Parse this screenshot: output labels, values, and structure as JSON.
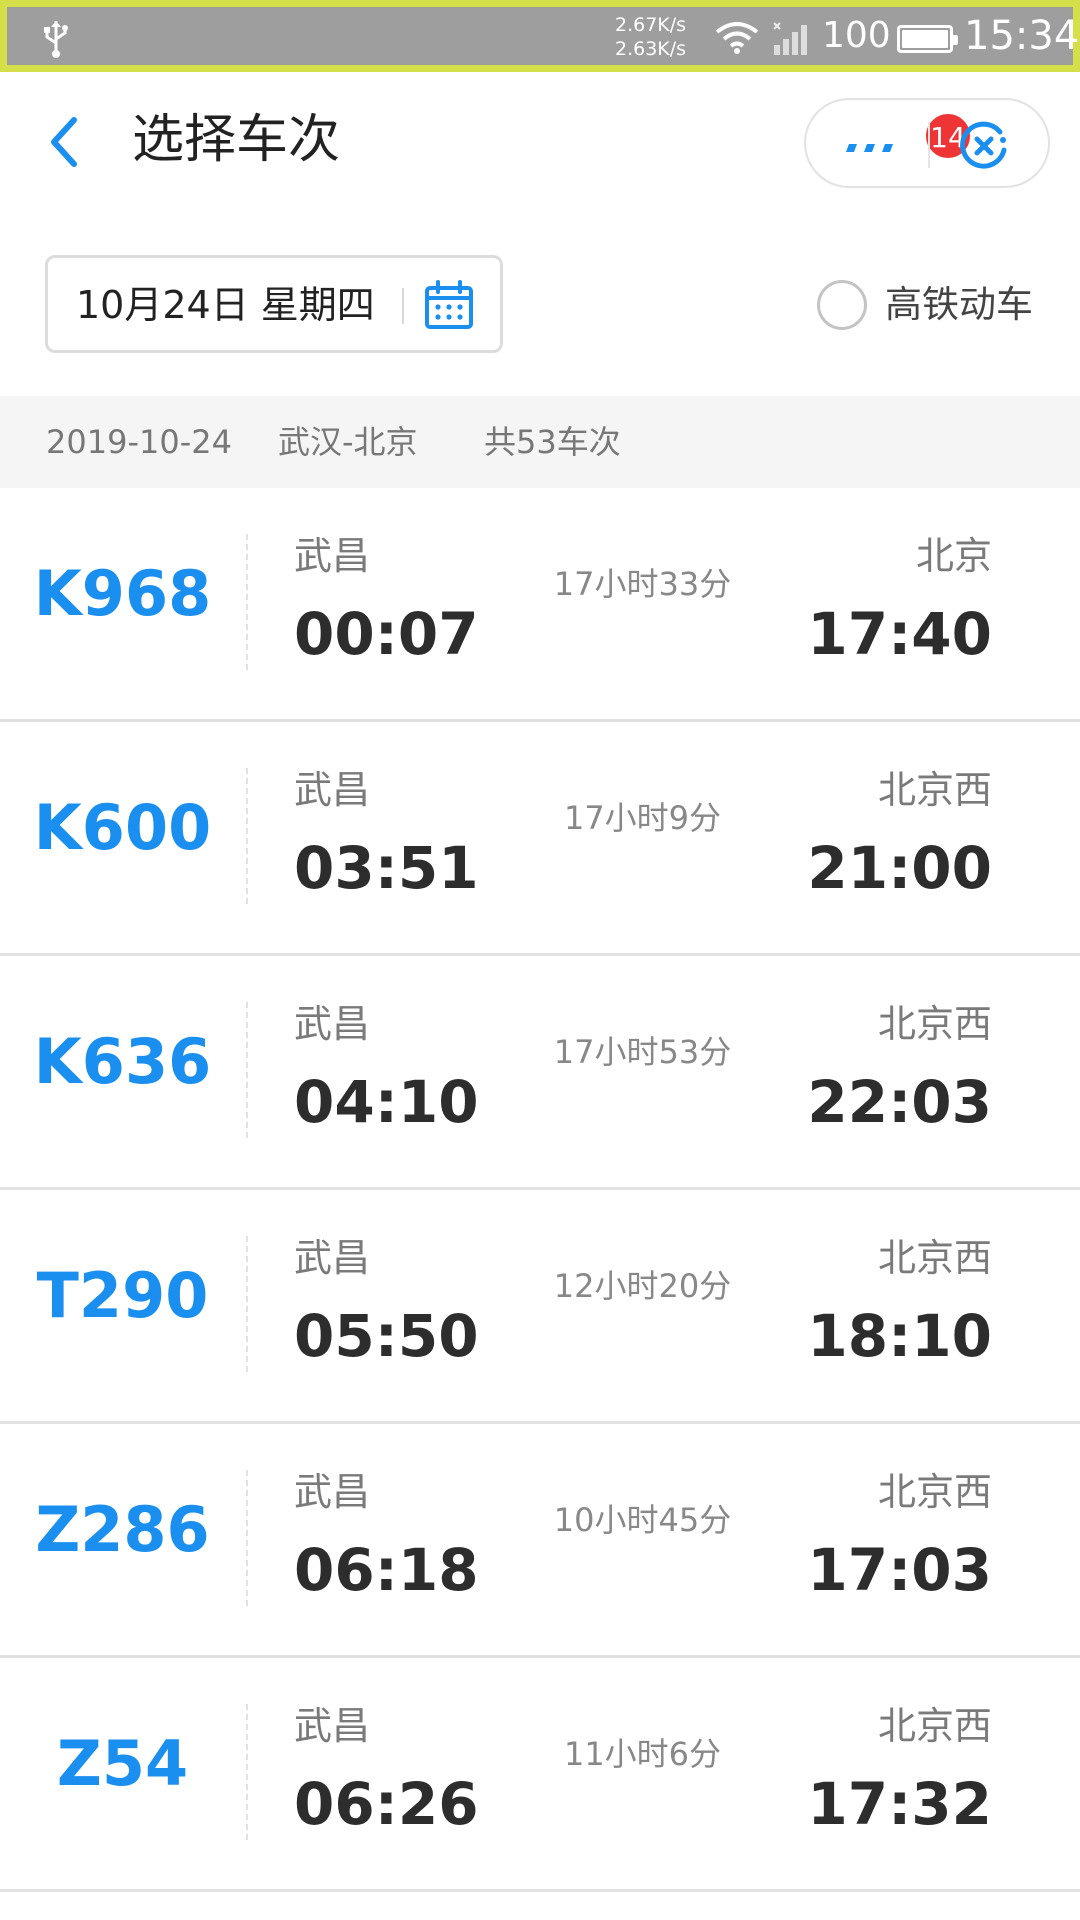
{
  "status_bar": {
    "speed_up": "2.67K/s",
    "speed_down": "2.63K/s",
    "battery": "100",
    "time": "15:34"
  },
  "header": {
    "title": "选择车次",
    "badge_count": "14",
    "accent": "#1b8ff0"
  },
  "date_selector": {
    "date_label": "10月24日 星期四"
  },
  "filter": {
    "label": "高铁动车",
    "checked": false
  },
  "info": {
    "date": "2019-10-24",
    "route": "武汉-北京",
    "count": "共53车次"
  },
  "trains": [
    {
      "no": "K968",
      "from": "武昌",
      "dep": "00:07",
      "duration": "17小时33分",
      "to": "北京",
      "arr": "17:40"
    },
    {
      "no": "K600",
      "from": "武昌",
      "dep": "03:51",
      "duration": "17小时9分",
      "to": "北京西",
      "arr": "21:00"
    },
    {
      "no": "K636",
      "from": "武昌",
      "dep": "04:10",
      "duration": "17小时53分",
      "to": "北京西",
      "arr": "22:03"
    },
    {
      "no": "T290",
      "from": "武昌",
      "dep": "05:50",
      "duration": "12小时20分",
      "to": "北京西",
      "arr": "18:10"
    },
    {
      "no": "Z286",
      "from": "武昌",
      "dep": "06:18",
      "duration": "10小时45分",
      "to": "北京西",
      "arr": "17:03"
    },
    {
      "no": "Z54",
      "from": "武昌",
      "dep": "06:26",
      "duration": "11小时6分",
      "to": "北京西",
      "arr": "17:32"
    }
  ]
}
